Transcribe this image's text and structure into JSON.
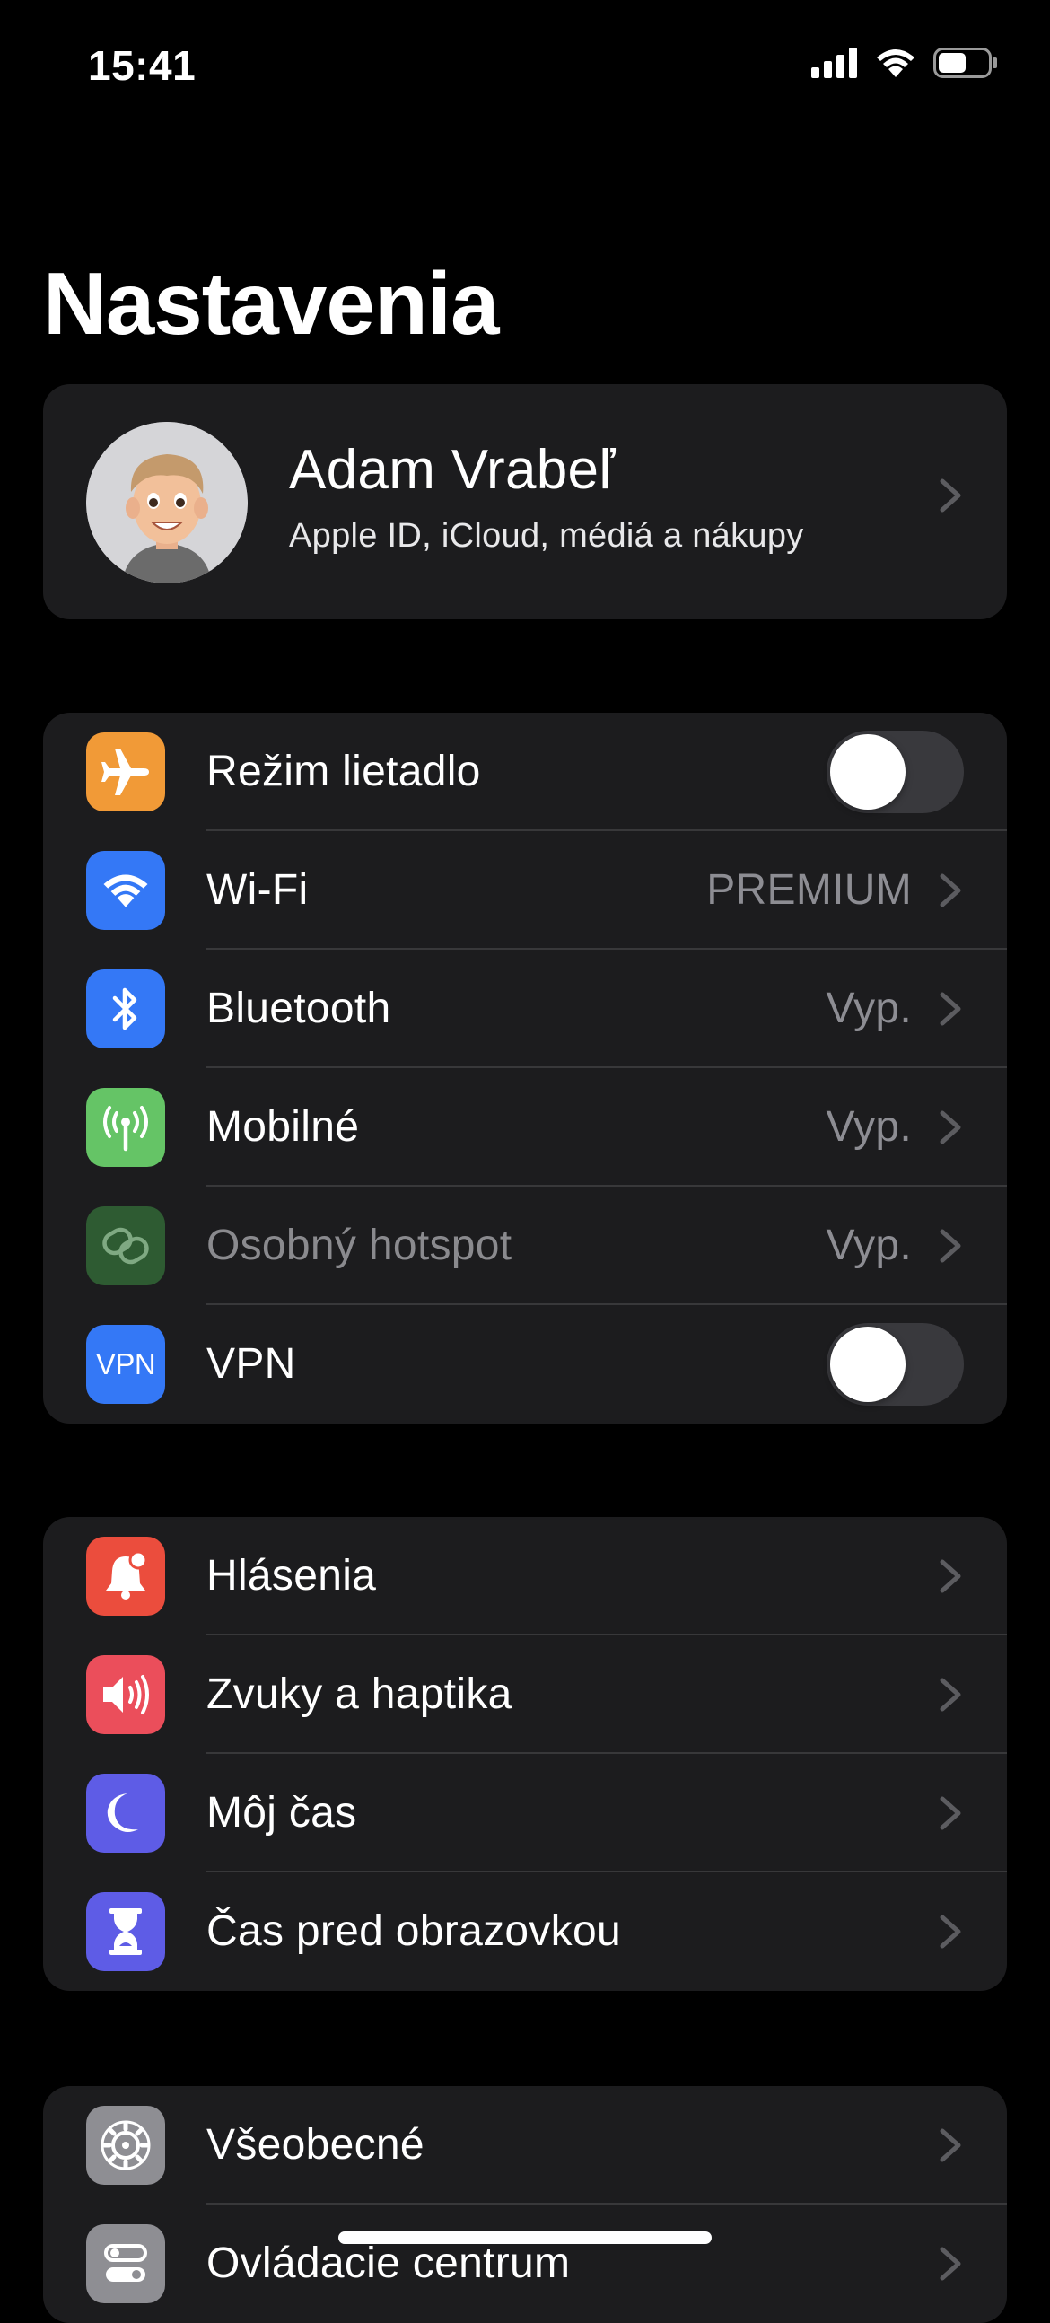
{
  "status_bar": {
    "time": "15:41"
  },
  "title": "Nastavenia",
  "profile": {
    "name": "Adam Vrabeľ",
    "subtitle": "Apple ID, iCloud, médiá a nákupy"
  },
  "connectivity": [
    {
      "label": "Režim lietadlo",
      "icon": "airplane-icon",
      "color": "#f19a37",
      "toggle": false
    },
    {
      "label": "Wi-Fi",
      "icon": "wifi-icon",
      "color": "#3478f6",
      "value": "PREMIUM"
    },
    {
      "label": "Bluetooth",
      "icon": "bluetooth-icon",
      "color": "#3478f6",
      "value": "Vyp."
    },
    {
      "label": "Mobilné",
      "icon": "antenna-icon",
      "color": "#65c466",
      "value": "Vyp."
    },
    {
      "label": "Osobný hotspot",
      "icon": "hotspot-icon",
      "color": "#2e5b32",
      "value": "Vyp.",
      "disabled": true
    },
    {
      "label": "VPN",
      "icon": "vpn-icon",
      "icon_text": "VPN",
      "color": "#3478f6",
      "toggle": false
    }
  ],
  "notifications": [
    {
      "label": "Hlásenia",
      "icon": "bell-icon",
      "color": "#eb4d3d"
    },
    {
      "label": "Zvuky a haptika",
      "icon": "speaker-icon",
      "color": "#eb4e5b"
    },
    {
      "label": "Môj čas",
      "icon": "moon-icon",
      "color": "#5e5ce6"
    },
    {
      "label": "Čas pred obrazovkou",
      "icon": "hourglass-icon",
      "color": "#5e5ce6"
    }
  ],
  "general": [
    {
      "label": "Všeobecné",
      "icon": "gear-icon",
      "color": "#8e8e93"
    },
    {
      "label": "Ovládacie centrum",
      "icon": "switches-icon",
      "color": "#8e8e93"
    }
  ]
}
